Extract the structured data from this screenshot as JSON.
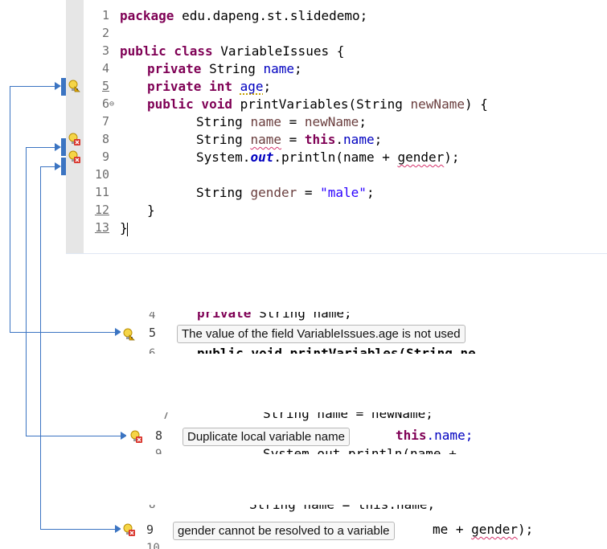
{
  "editor": {
    "lines": [
      {
        "num": "1"
      },
      {
        "num": "2"
      },
      {
        "num": "3"
      },
      {
        "num": "4"
      },
      {
        "num": "5"
      },
      {
        "num": "6"
      },
      {
        "num": "7"
      },
      {
        "num": "8"
      },
      {
        "num": "9"
      },
      {
        "num": "10"
      },
      {
        "num": "11"
      },
      {
        "num": "12"
      },
      {
        "num": "13"
      }
    ],
    "code": {
      "l1_kw": "package",
      "l1_rest": " edu.dapeng.st.slidedemo;",
      "l3_kw": "public class",
      "l3_rest": " VariableIssues {",
      "l4_kw": "private",
      "l4_type": " String ",
      "l4_field": "name",
      "l4_end": ";",
      "l5_kw": "private int",
      "l5_field": "age",
      "l5_end": ";",
      "l6_kw": "public void",
      "l6_mid": " printVariables(String ",
      "l6_param": "newName",
      "l6_end": ") {",
      "l7_type": "String ",
      "l7_var": "name",
      "l7_eq": " = ",
      "l7_param": "newName",
      "l7_end": ";",
      "l8_type": "String ",
      "l8_var": "name",
      "l8_eq": " = ",
      "l8_this": "this",
      "l8_dot": ".",
      "l8_field": "name",
      "l8_end": ";",
      "l9_sys": "System.",
      "l9_out": "out",
      "l9_call": ".println(name + ",
      "l9_gender": "gender",
      "l9_end": ");",
      "l11_type": "String ",
      "l11_var": "gender",
      "l11_eq": " = ",
      "l11_str": "\"male\"",
      "l11_end": ";",
      "l12": "}",
      "l13": "}"
    }
  },
  "snippets": [
    {
      "top_num": "4",
      "top_code_kw": "private",
      "top_code_rest": " String name;",
      "mid_num": "5",
      "tooltip": "The value of the field VariableIssues.age is not used",
      "bottom_num": "6",
      "bottom_code": "public void printVariables(String ne"
    },
    {
      "top_num": "7",
      "top_code": "String name = newName;",
      "mid_num": "8",
      "tooltip": "Duplicate local variable name",
      "after_kw": "this",
      "after_rest": ".name;",
      "bottom_num": "9",
      "bottom_code": "System.out.println(name +"
    },
    {
      "top_num": "8",
      "top_code": "String name = this.name;",
      "mid_num": "9",
      "tooltip": "gender cannot be resolved to a variable",
      "after_rest": "me + ",
      "after_gender": "gender",
      "after_end": ");",
      "bottom_num": "10"
    }
  ],
  "icons": {
    "warning": "warning-lightbulb-icon",
    "error": "error-lightbulb-icon",
    "fold": "collapse-icon"
  },
  "colors": {
    "keyword": "#7f0055",
    "field": "#0000c0",
    "string": "#2a00ff",
    "connector": "#3b74c2"
  }
}
